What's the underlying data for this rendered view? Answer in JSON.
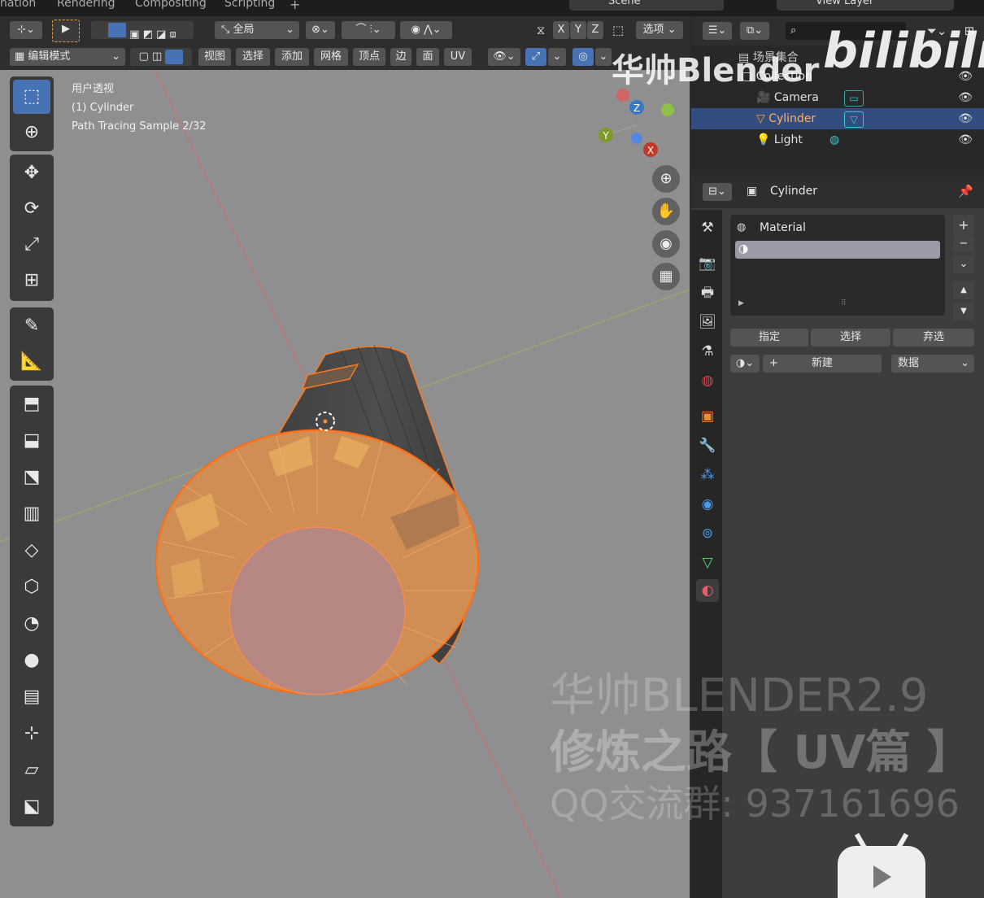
{
  "top_tabs": [
    "nation",
    "Rendering",
    "Compositing",
    "Scripting",
    "+"
  ],
  "top_right": {
    "scene_label": "Scene",
    "view_layer_label": "View Layer"
  },
  "header1": {
    "orientation_label": "全局",
    "axes": [
      "X",
      "Y",
      "Z"
    ],
    "options_label": "选项"
  },
  "header2": {
    "mode_label": "编辑模式",
    "menus": [
      "视图",
      "选择",
      "添加",
      "网格",
      "顶点",
      "边",
      "面",
      "UV"
    ]
  },
  "viewport": {
    "overlay_lines": [
      "用户透视",
      "(1) Cylinder",
      "Path Tracing Sample 2/32"
    ],
    "gizmo_axes": {
      "x": "X",
      "y": "Y",
      "z": "Z"
    }
  },
  "outliner": {
    "header_label": "场景集合",
    "rows": [
      {
        "label": "Collection",
        "icon": "collection-icon"
      },
      {
        "label": "Camera",
        "icon": "camera-icon"
      },
      {
        "label": "Cylinder",
        "icon": "mesh-icon"
      },
      {
        "label": "Light",
        "icon": "light-icon"
      }
    ]
  },
  "properties": {
    "object_name": "Cylinder",
    "slot_name": "Material",
    "assign_buttons": [
      "指定",
      "选择",
      "弃选"
    ],
    "new_button": "新建",
    "data_dropdown": "数据"
  },
  "watermarks": {
    "channel": "华帅Blender",
    "site": "bilibili",
    "line1": "华帅BLENDER2.9",
    "line2": "修炼之路【 UV篇 】",
    "line3": "QQ交流群: 937161696"
  },
  "colors": {
    "accent_blue": "#4772b3",
    "selection_orange": "#ff8a1e",
    "viewport_bg": "#8f8f8f",
    "red_axis": "#e06060",
    "green_axis": "#9fb34a"
  }
}
